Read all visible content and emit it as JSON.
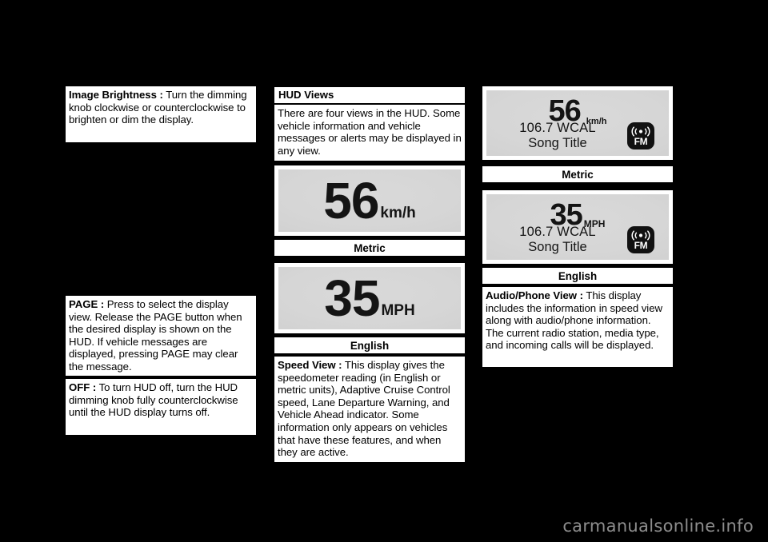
{
  "page": {
    "background_color": "#000000",
    "watermark": "carmanualsonline.info",
    "watermark_color": "#8d8d8d"
  },
  "column_left": {
    "image_brightness": {
      "term": "Image Brightness :",
      "text": " Turn the dimming knob clockwise or counterclockwise to brighten or dim the display."
    },
    "page_button": {
      "term": "PAGE :",
      "text": "  Press to select the display view. Release the PAGE button when the desired display is shown on the HUD. If vehicle messages are displayed, pressing PAGE may clear the message."
    },
    "off": {
      "term": "OFF :",
      "text": "  To turn HUD off, turn the HUD dimming knob fully counterclockwise until the HUD display turns off."
    }
  },
  "column_middle": {
    "heading": "HUD Views",
    "intro": "There are four views in the HUD. Some vehicle information and vehicle messages or alerts may be displayed in any view.",
    "hud_metric": {
      "speed": "56",
      "unit": "km/h",
      "caption": "Metric"
    },
    "hud_english": {
      "speed": "35",
      "unit": "MPH",
      "caption": "English"
    },
    "speed_view": {
      "term": "Speed View :",
      "text": " This display gives the speedometer reading (in English or metric units), Adaptive Cruise Control speed, Lane Departure Warning, and Vehicle Ahead indicator. Some information only appears on vehicles that have these features, and when they are active."
    }
  },
  "column_right": {
    "hud_audio_metric": {
      "speed": "56",
      "unit": "km/h",
      "radio_station": "106.7  WCAL",
      "song_title": "Song Title",
      "media_type": "FM",
      "caption": "Metric"
    },
    "hud_audio_english": {
      "speed": "35",
      "unit": "MPH",
      "radio_station": "106.7 WCAL",
      "song_title": "Song Title",
      "media_type": "FM",
      "caption": "English"
    },
    "audio_phone_view": {
      "term": "Audio/Phone View :",
      "text": " This display includes the information in speed view along with audio/phone information. The current radio station, media type, and incoming calls will be displayed."
    }
  }
}
